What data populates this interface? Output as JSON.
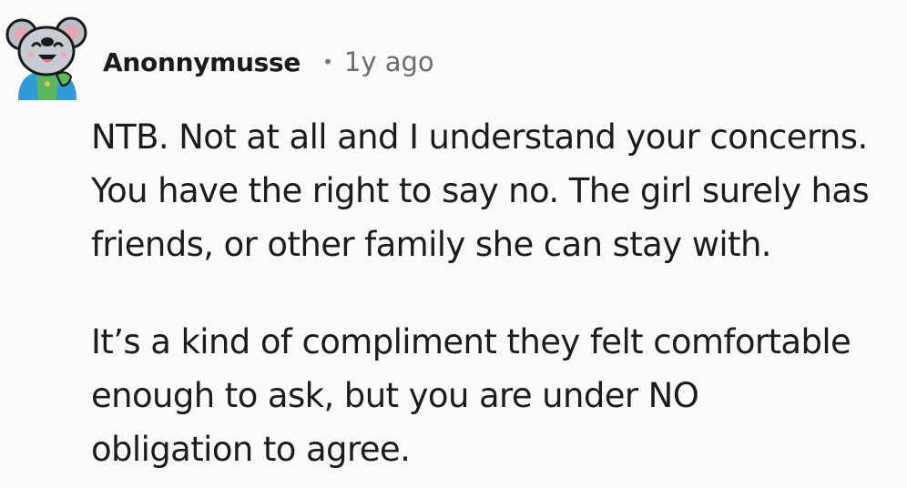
{
  "comment": {
    "author": "Anonnymusse",
    "separator": "•",
    "age": "1y ago",
    "avatar": "snoo-koala-avatar",
    "paragraphs": [
      "NTB. Not at all and I understand your concerns.\nYou have the right to say no. The girl surely has\nfriends, or other family she can stay with.",
      "It’s a kind of compliment they felt comfortable\nenough to ask, but you are under NO\nobligation to agree."
    ]
  },
  "colors": {
    "background": "#fafafa",
    "text": "#1c1c1c",
    "muted": "#6a6d70"
  }
}
